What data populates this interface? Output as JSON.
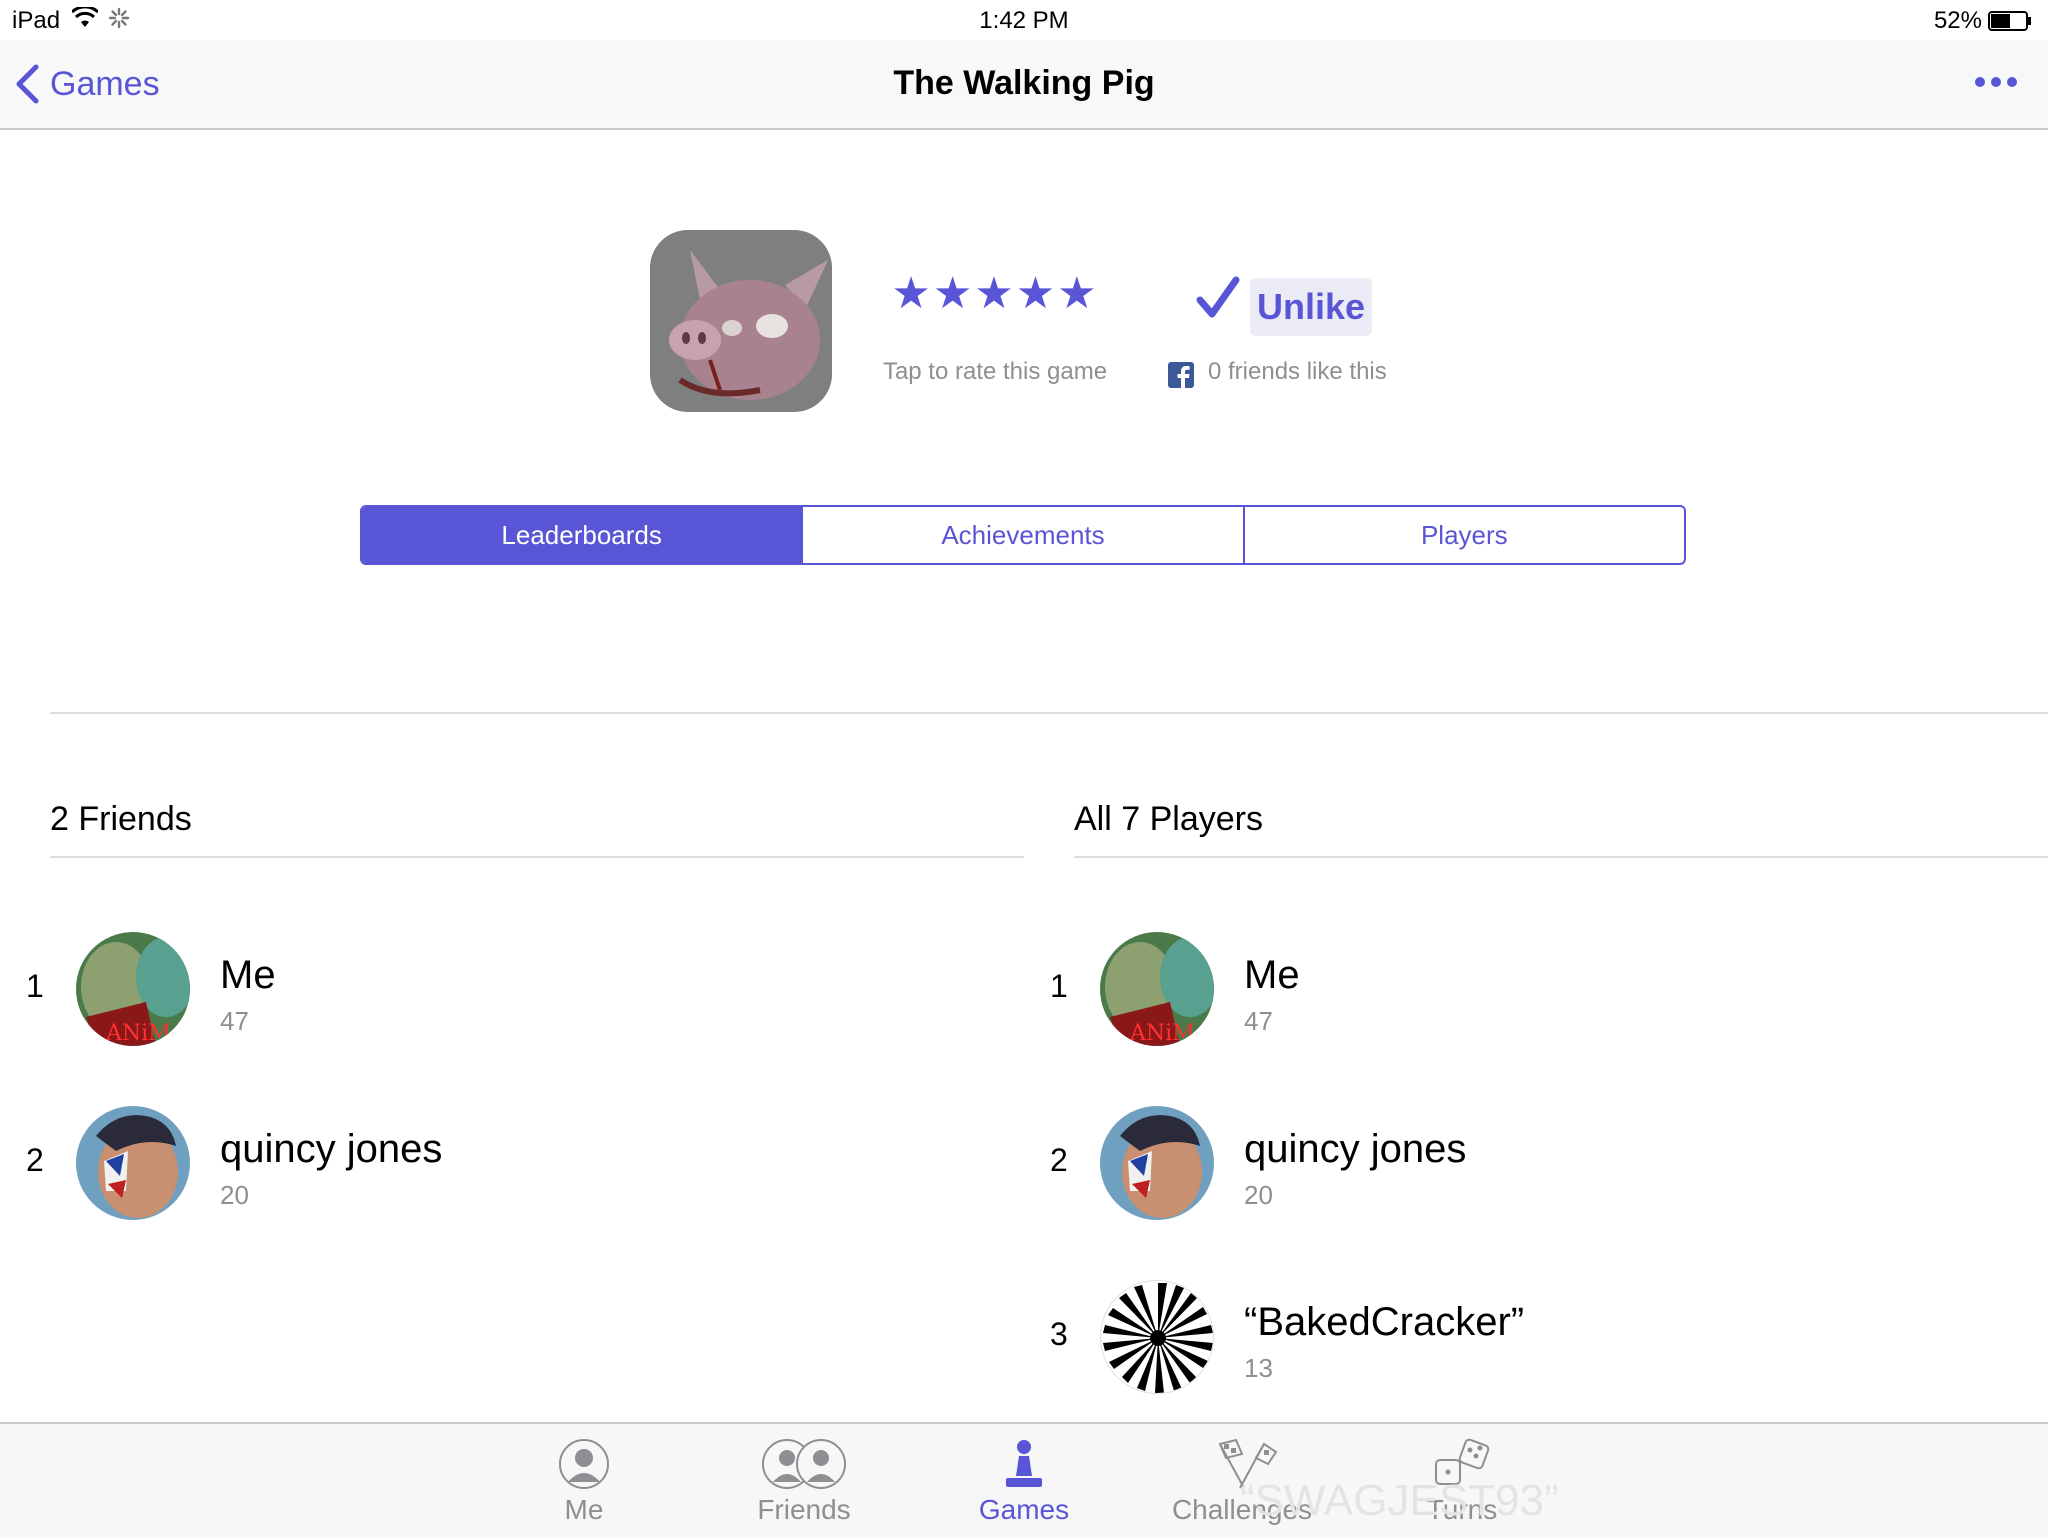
{
  "status_bar": {
    "device": "iPad",
    "time": "1:42 PM",
    "battery": "52%"
  },
  "nav": {
    "back_label": "Games",
    "title": "The Walking Pig"
  },
  "game": {
    "stars": "★★★★★",
    "rate_hint": "Tap to rate this game",
    "unlike_label": "Unlike",
    "friends_like": "0 friends like this"
  },
  "segments": [
    {
      "label": "Leaderboards",
      "active": true
    },
    {
      "label": "Achievements",
      "active": false
    },
    {
      "label": "Players",
      "active": false
    }
  ],
  "friends_board": {
    "title": "2 Friends",
    "entries": [
      {
        "rank": "1",
        "name": "Me",
        "score": "47"
      },
      {
        "rank": "2",
        "name": "quincy jones",
        "score": "20"
      }
    ]
  },
  "all_board": {
    "title": "All 7 Players",
    "entries": [
      {
        "rank": "1",
        "name": "Me",
        "score": "47"
      },
      {
        "rank": "2",
        "name": "quincy jones",
        "score": "20"
      },
      {
        "rank": "3",
        "name": "“BakedCracker”",
        "score": "13"
      }
    ]
  },
  "tabs": [
    {
      "label": "Me",
      "icon": "person-icon",
      "active": false
    },
    {
      "label": "Friends",
      "icon": "friends-icon",
      "active": false
    },
    {
      "label": "Games",
      "icon": "pawn-icon",
      "active": true
    },
    {
      "label": "Challenges",
      "icon": "flags-icon",
      "active": false
    },
    {
      "label": "Turns",
      "icon": "dice-icon",
      "active": false
    }
  ],
  "ghost_text": "“SWAGJEST93”",
  "colors": {
    "accent": "#5856d6",
    "secondary_text": "#8e8e93",
    "separator": "#dcdcdc"
  }
}
